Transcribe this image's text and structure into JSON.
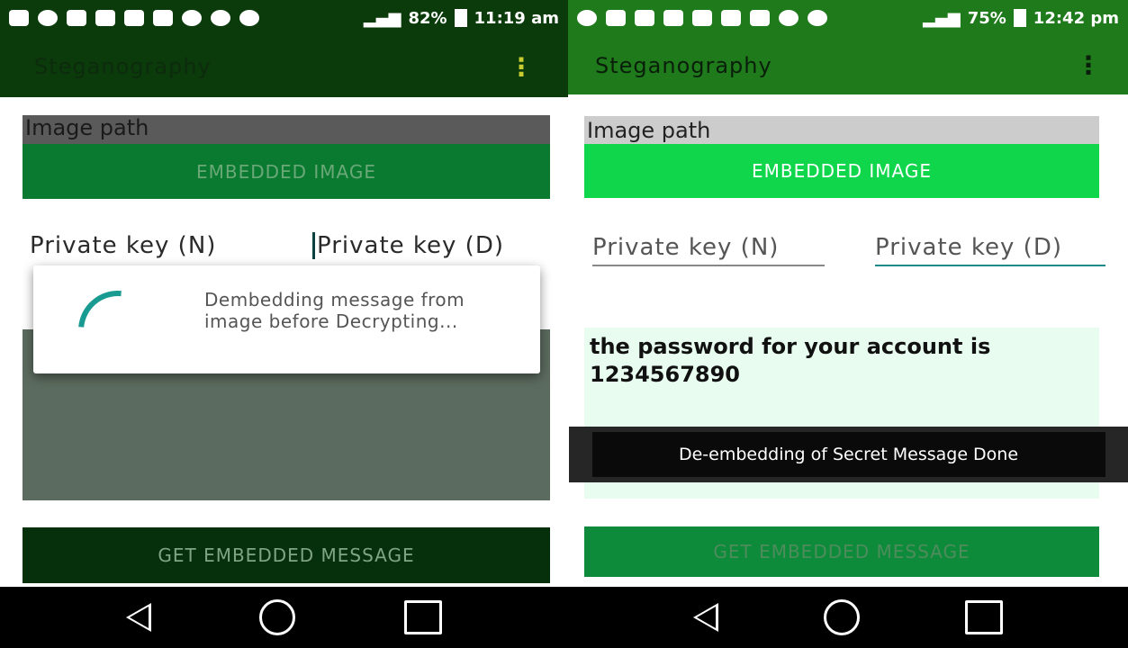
{
  "left": {
    "status": {
      "battery": "82%",
      "time": "11:19 am"
    },
    "app_title": "Steganography",
    "image_path_label": "Image path",
    "embedded_image_button": "EMBEDDED IMAGE",
    "private_key_n": "Private key (N)",
    "private_key_d": "Private key (D)",
    "dialog_message": "Dembedding message from image before Decrypting...",
    "get_message_button": "GET EMBEDDED MESSAGE"
  },
  "right": {
    "status": {
      "battery": "75%",
      "time": "12:42 pm"
    },
    "app_title": "Steganography",
    "image_path_label": "Image path",
    "embedded_image_button": "EMBEDDED IMAGE",
    "private_key_n": "Private key (N)",
    "private_key_d": "Private key (D)",
    "message_text": "the password for your account is 1234567890",
    "get_message_button": "GET EMBEDDED MESSAGE",
    "toast": "De-embedding of Secret Message Done"
  },
  "icons": {
    "overflow": "more-vert-icon",
    "nav": [
      "back-icon",
      "home-icon",
      "recents-icon"
    ]
  },
  "colors": {
    "left_appbar": "#0b3a0b",
    "right_appbar": "#1f7a1c",
    "right_button": "#10d64c",
    "accent": "#1a9b92"
  }
}
